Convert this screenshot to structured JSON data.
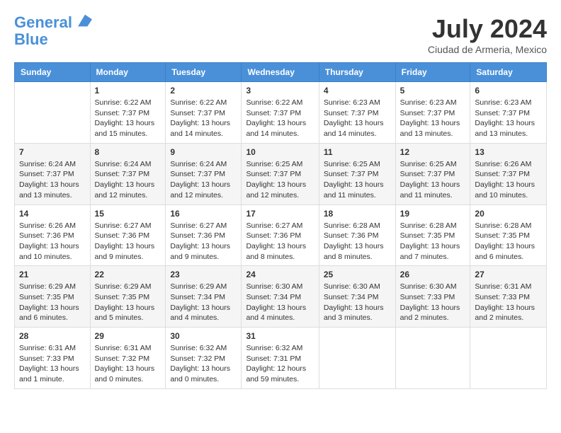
{
  "header": {
    "logo_line1": "General",
    "logo_line2": "Blue",
    "month_title": "July 2024",
    "location": "Ciudad de Armeria, Mexico"
  },
  "weekdays": [
    "Sunday",
    "Monday",
    "Tuesday",
    "Wednesday",
    "Thursday",
    "Friday",
    "Saturday"
  ],
  "weeks": [
    [
      {
        "num": "",
        "sunrise": "",
        "sunset": "",
        "daylight": ""
      },
      {
        "num": "1",
        "sunrise": "Sunrise: 6:22 AM",
        "sunset": "Sunset: 7:37 PM",
        "daylight": "Daylight: 13 hours and 15 minutes."
      },
      {
        "num": "2",
        "sunrise": "Sunrise: 6:22 AM",
        "sunset": "Sunset: 7:37 PM",
        "daylight": "Daylight: 13 hours and 14 minutes."
      },
      {
        "num": "3",
        "sunrise": "Sunrise: 6:22 AM",
        "sunset": "Sunset: 7:37 PM",
        "daylight": "Daylight: 13 hours and 14 minutes."
      },
      {
        "num": "4",
        "sunrise": "Sunrise: 6:23 AM",
        "sunset": "Sunset: 7:37 PM",
        "daylight": "Daylight: 13 hours and 14 minutes."
      },
      {
        "num": "5",
        "sunrise": "Sunrise: 6:23 AM",
        "sunset": "Sunset: 7:37 PM",
        "daylight": "Daylight: 13 hours and 13 minutes."
      },
      {
        "num": "6",
        "sunrise": "Sunrise: 6:23 AM",
        "sunset": "Sunset: 7:37 PM",
        "daylight": "Daylight: 13 hours and 13 minutes."
      }
    ],
    [
      {
        "num": "7",
        "sunrise": "Sunrise: 6:24 AM",
        "sunset": "Sunset: 7:37 PM",
        "daylight": "Daylight: 13 hours and 13 minutes."
      },
      {
        "num": "8",
        "sunrise": "Sunrise: 6:24 AM",
        "sunset": "Sunset: 7:37 PM",
        "daylight": "Daylight: 13 hours and 12 minutes."
      },
      {
        "num": "9",
        "sunrise": "Sunrise: 6:24 AM",
        "sunset": "Sunset: 7:37 PM",
        "daylight": "Daylight: 13 hours and 12 minutes."
      },
      {
        "num": "10",
        "sunrise": "Sunrise: 6:25 AM",
        "sunset": "Sunset: 7:37 PM",
        "daylight": "Daylight: 13 hours and 12 minutes."
      },
      {
        "num": "11",
        "sunrise": "Sunrise: 6:25 AM",
        "sunset": "Sunset: 7:37 PM",
        "daylight": "Daylight: 13 hours and 11 minutes."
      },
      {
        "num": "12",
        "sunrise": "Sunrise: 6:25 AM",
        "sunset": "Sunset: 7:37 PM",
        "daylight": "Daylight: 13 hours and 11 minutes."
      },
      {
        "num": "13",
        "sunrise": "Sunrise: 6:26 AM",
        "sunset": "Sunset: 7:37 PM",
        "daylight": "Daylight: 13 hours and 10 minutes."
      }
    ],
    [
      {
        "num": "14",
        "sunrise": "Sunrise: 6:26 AM",
        "sunset": "Sunset: 7:36 PM",
        "daylight": "Daylight: 13 hours and 10 minutes."
      },
      {
        "num": "15",
        "sunrise": "Sunrise: 6:27 AM",
        "sunset": "Sunset: 7:36 PM",
        "daylight": "Daylight: 13 hours and 9 minutes."
      },
      {
        "num": "16",
        "sunrise": "Sunrise: 6:27 AM",
        "sunset": "Sunset: 7:36 PM",
        "daylight": "Daylight: 13 hours and 9 minutes."
      },
      {
        "num": "17",
        "sunrise": "Sunrise: 6:27 AM",
        "sunset": "Sunset: 7:36 PM",
        "daylight": "Daylight: 13 hours and 8 minutes."
      },
      {
        "num": "18",
        "sunrise": "Sunrise: 6:28 AM",
        "sunset": "Sunset: 7:36 PM",
        "daylight": "Daylight: 13 hours and 8 minutes."
      },
      {
        "num": "19",
        "sunrise": "Sunrise: 6:28 AM",
        "sunset": "Sunset: 7:35 PM",
        "daylight": "Daylight: 13 hours and 7 minutes."
      },
      {
        "num": "20",
        "sunrise": "Sunrise: 6:28 AM",
        "sunset": "Sunset: 7:35 PM",
        "daylight": "Daylight: 13 hours and 6 minutes."
      }
    ],
    [
      {
        "num": "21",
        "sunrise": "Sunrise: 6:29 AM",
        "sunset": "Sunset: 7:35 PM",
        "daylight": "Daylight: 13 hours and 6 minutes."
      },
      {
        "num": "22",
        "sunrise": "Sunrise: 6:29 AM",
        "sunset": "Sunset: 7:35 PM",
        "daylight": "Daylight: 13 hours and 5 minutes."
      },
      {
        "num": "23",
        "sunrise": "Sunrise: 6:29 AM",
        "sunset": "Sunset: 7:34 PM",
        "daylight": "Daylight: 13 hours and 4 minutes."
      },
      {
        "num": "24",
        "sunrise": "Sunrise: 6:30 AM",
        "sunset": "Sunset: 7:34 PM",
        "daylight": "Daylight: 13 hours and 4 minutes."
      },
      {
        "num": "25",
        "sunrise": "Sunrise: 6:30 AM",
        "sunset": "Sunset: 7:34 PM",
        "daylight": "Daylight: 13 hours and 3 minutes."
      },
      {
        "num": "26",
        "sunrise": "Sunrise: 6:30 AM",
        "sunset": "Sunset: 7:33 PM",
        "daylight": "Daylight: 13 hours and 2 minutes."
      },
      {
        "num": "27",
        "sunrise": "Sunrise: 6:31 AM",
        "sunset": "Sunset: 7:33 PM",
        "daylight": "Daylight: 13 hours and 2 minutes."
      }
    ],
    [
      {
        "num": "28",
        "sunrise": "Sunrise: 6:31 AM",
        "sunset": "Sunset: 7:33 PM",
        "daylight": "Daylight: 13 hours and 1 minute."
      },
      {
        "num": "29",
        "sunrise": "Sunrise: 6:31 AM",
        "sunset": "Sunset: 7:32 PM",
        "daylight": "Daylight: 13 hours and 0 minutes."
      },
      {
        "num": "30",
        "sunrise": "Sunrise: 6:32 AM",
        "sunset": "Sunset: 7:32 PM",
        "daylight": "Daylight: 13 hours and 0 minutes."
      },
      {
        "num": "31",
        "sunrise": "Sunrise: 6:32 AM",
        "sunset": "Sunset: 7:31 PM",
        "daylight": "Daylight: 12 hours and 59 minutes."
      },
      {
        "num": "",
        "sunrise": "",
        "sunset": "",
        "daylight": ""
      },
      {
        "num": "",
        "sunrise": "",
        "sunset": "",
        "daylight": ""
      },
      {
        "num": "",
        "sunrise": "",
        "sunset": "",
        "daylight": ""
      }
    ]
  ]
}
